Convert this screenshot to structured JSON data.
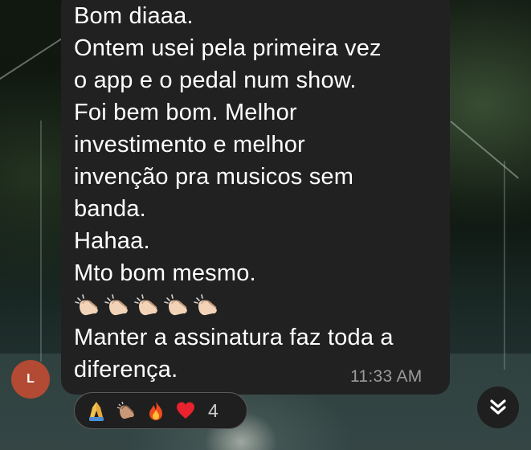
{
  "message": {
    "lines_before": [
      "Bom diaaa.",
      "Ontem usei pela primeira vez",
      "o app e o pedal num show.",
      "Foi bem bom. Melhor",
      "investimento e melhor",
      "invenção pra musicos sem",
      "banda.",
      "Hahaa.",
      "Mto bom mesmo."
    ],
    "clap_emoji_count": 5,
    "lines_after": [
      "Manter a assinatura faz toda a",
      "diferença."
    ],
    "timestamp": "11:33 AM"
  },
  "sender": {
    "avatar_initial": "L",
    "avatar_color": "#b34a34"
  },
  "reactions": {
    "icons": [
      "folded-hands-icon",
      "clapping-hands-icon",
      "fire-icon",
      "red-heart-icon"
    ],
    "count": "4"
  },
  "scroll_button": {
    "icon": "double-chevron-down-icon"
  },
  "colors": {
    "bubble": "#212121",
    "text": "#ffffff",
    "timestamp": "#9b9b9b",
    "pill_bg": "#1f1f1f",
    "pill_border": "#5a5a5a"
  }
}
